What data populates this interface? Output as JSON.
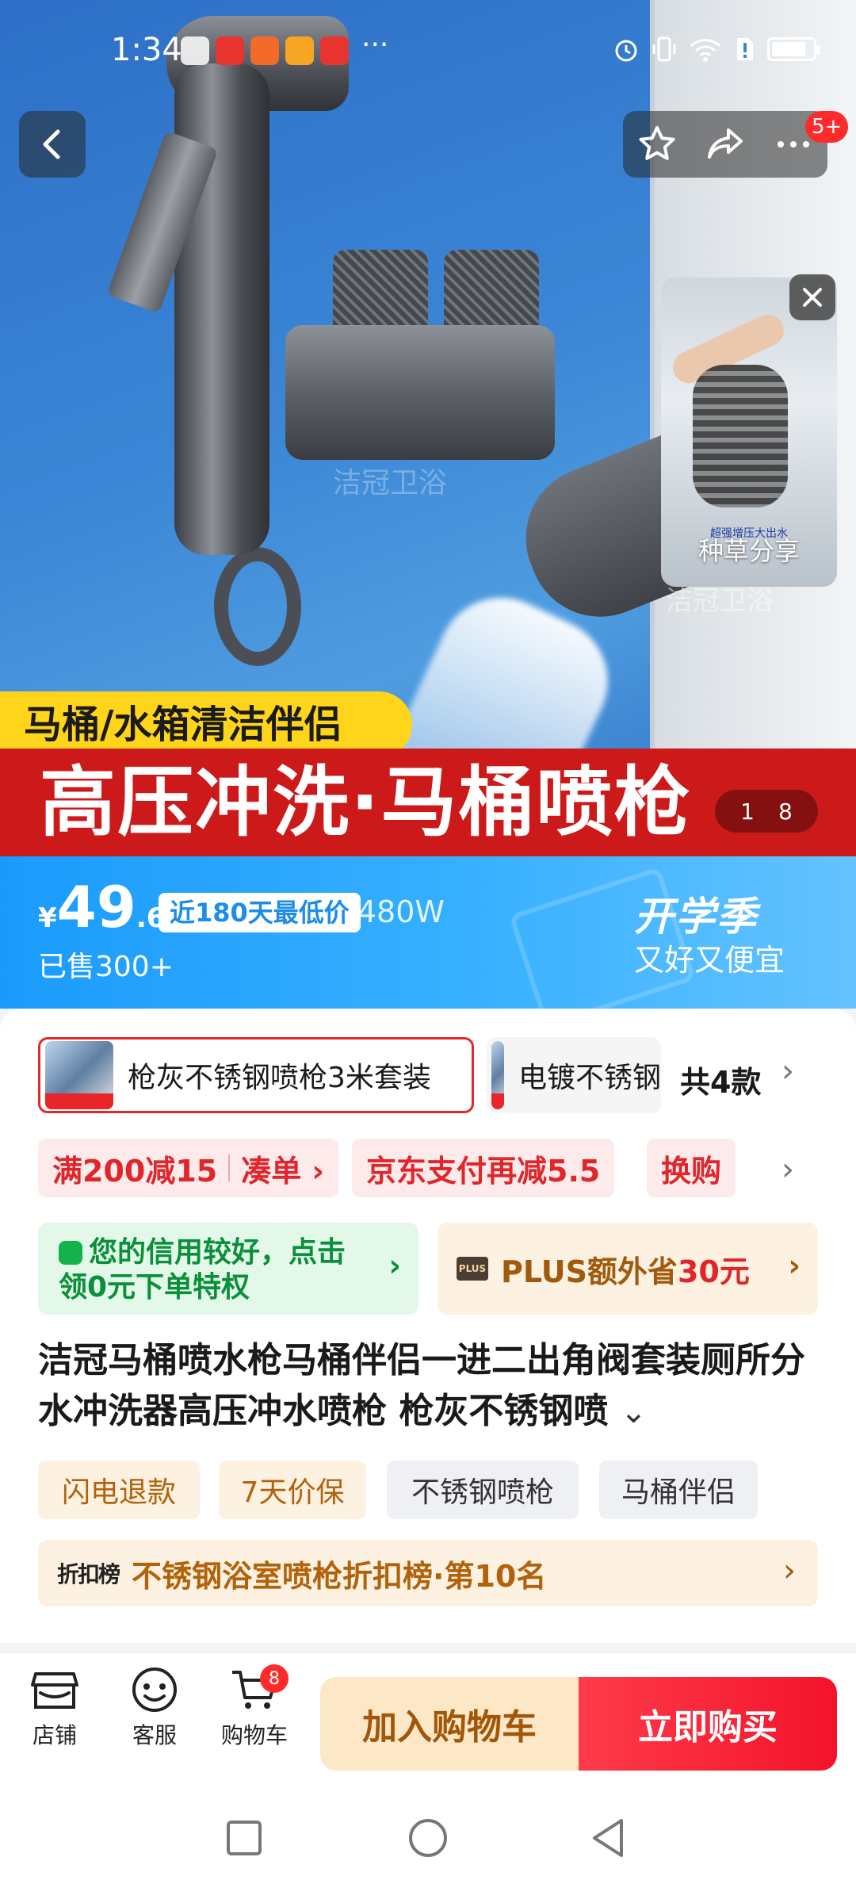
{
  "status_bar": {
    "time": "1:34"
  },
  "hero": {
    "yellow_banner": "马桶/水箱清洁伴侣",
    "red_banner": "高压冲洗·马桶喷枪",
    "counter_current": "1",
    "counter_total": "8",
    "watermark": "洁冠卫浴"
  },
  "top_actions": {
    "badge": "5+"
  },
  "floating_video": {
    "label": "种草分享",
    "small_text": "超强增压大出水"
  },
  "price": {
    "currency": "¥",
    "integer": "49",
    "decimal": ".6",
    "tag": "近180天最低价",
    "code": "74257480W",
    "sold": "已售300+",
    "season": "开学季",
    "season_sub": "又好又便宜"
  },
  "variants": {
    "selected": "枪灰不锈钢喷枪3米套装",
    "other": "电镀不锈钢",
    "count": "共4款"
  },
  "promos": {
    "p1a": "满200减15",
    "p1b": "凑单 ›",
    "p2": "京东支付再减5.5",
    "p3": "换购"
  },
  "credit": {
    "text": "您的信用较好，点击领0元下单特权"
  },
  "plus": {
    "logo": "PLUS",
    "text_prefix": "PLUS额外省",
    "amount": "30元"
  },
  "product_title": "洁冠马桶喷水枪马桶伴侣一进二出角阀套装厕所分水冲洗器高压冲水喷枪 枪灰不锈钢喷",
  "tags": [
    "闪电退款",
    "7天价保",
    "不锈钢喷枪",
    "马桶伴侣"
  ],
  "rank": {
    "logo": "折扣榜",
    "text": "不锈钢浴室喷枪折扣榜·第10名"
  },
  "bottom_nav": {
    "shop": "店铺",
    "service": "客服",
    "cart": "购物车",
    "cart_badge": "8"
  },
  "buttons": {
    "add_cart": "加入购物车",
    "buy_now": "立即购买"
  }
}
